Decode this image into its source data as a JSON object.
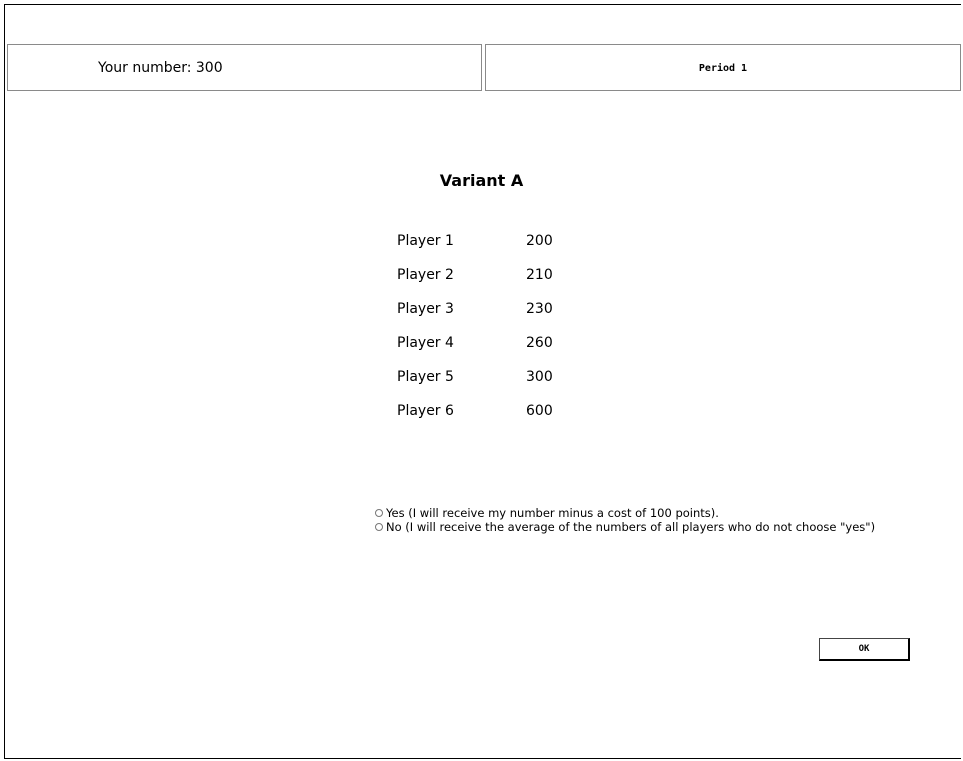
{
  "header": {
    "your_number_label": "Your number: 300",
    "period_label": "Period 1"
  },
  "main": {
    "title": "Variant A",
    "players": [
      {
        "name": "Player 1",
        "value": "200"
      },
      {
        "name": "Player 2",
        "value": "210"
      },
      {
        "name": "Player 3",
        "value": "230"
      },
      {
        "name": "Player 4",
        "value": "260"
      },
      {
        "name": "Player 5",
        "value": "300"
      },
      {
        "name": "Player 6",
        "value": "600"
      }
    ],
    "choices": {
      "yes_label": "Yes (I will receive my number minus a cost of 100 points).",
      "no_label": "No (I will receive the average of the numbers of all players who do not choose \"yes\")",
      "selected": null
    },
    "ok_label": "OK"
  }
}
